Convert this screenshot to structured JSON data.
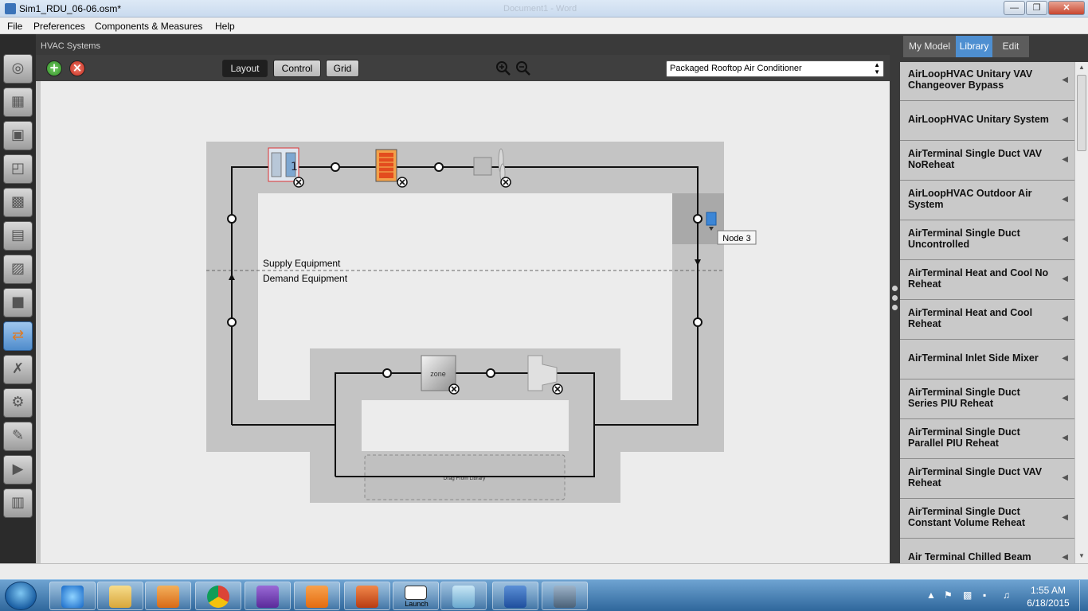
{
  "window": {
    "title": "Sim1_RDU_06-06.osm*",
    "ghost_title": "Document1 - Word",
    "controls": [
      "minimize-icon",
      "restore-icon",
      "close-icon"
    ]
  },
  "menu": [
    "File",
    "Preferences",
    "Components & Measures",
    "Help"
  ],
  "left_tools": [
    {
      "icon": "site-globe-icon"
    },
    {
      "icon": "schedules-calendar-icon"
    },
    {
      "icon": "constructions-icon"
    },
    {
      "icon": "loads-outlet-icon"
    },
    {
      "icon": "space-types-icon"
    },
    {
      "icon": "geometry-icon"
    },
    {
      "icon": "facility-building-icon"
    },
    {
      "icon": "spaces-icon"
    },
    {
      "icon": "hvac-systems-icon",
      "active": true
    },
    {
      "icon": "building-summary-icon"
    },
    {
      "icon": "measures-gear-icon"
    },
    {
      "icon": "simulation-settings-icon"
    },
    {
      "icon": "run-simulation-icon"
    },
    {
      "icon": "results-chart-icon"
    }
  ],
  "panel": {
    "title": "HVAC Systems",
    "tabs": [
      "Layout",
      "Control",
      "Grid"
    ],
    "active_tab": "Layout",
    "system_select": "Packaged Rooftop Air Conditioner"
  },
  "diagram": {
    "supply_label": "Supply Equipment",
    "demand_label": "Demand Equipment",
    "zone_label": "zone",
    "drop_zone_label": "Drag From Library",
    "tooltip": "Node 3"
  },
  "right_panel": {
    "tabs": [
      "My Model",
      "Library",
      "Edit"
    ],
    "active_tab": "Library",
    "items": [
      "AirLoopHVAC Unitary VAV Changeover Bypass",
      "AirLoopHVAC Unitary System",
      "AirTerminal Single Duct VAV NoReheat",
      "AirLoopHVAC Outdoor Air System",
      "AirTerminal Single Duct Uncontrolled",
      "AirTerminal Heat and Cool No Reheat",
      "AirTerminal Heat and Cool Reheat",
      "AirTerminal Inlet Side Mixer",
      "AirTerminal Single Duct Series PIU Reheat",
      "AirTerminal Single Duct Parallel PIU Reheat",
      "AirTerminal Single Duct VAV Reheat",
      "AirTerminal Single Duct Constant Volume Reheat",
      "Air Terminal Chilled Beam"
    ]
  },
  "taskbar": {
    "apps": [
      "internet-explorer",
      "file-explorer",
      "media-player",
      "chrome",
      "visual-studio",
      "pdf-reader",
      "matlab",
      "eplus-launch",
      "sketchup",
      "word",
      "openstudio"
    ],
    "launch_label": "Launch",
    "time": "1:55 AM",
    "date": "6/18/2015"
  }
}
